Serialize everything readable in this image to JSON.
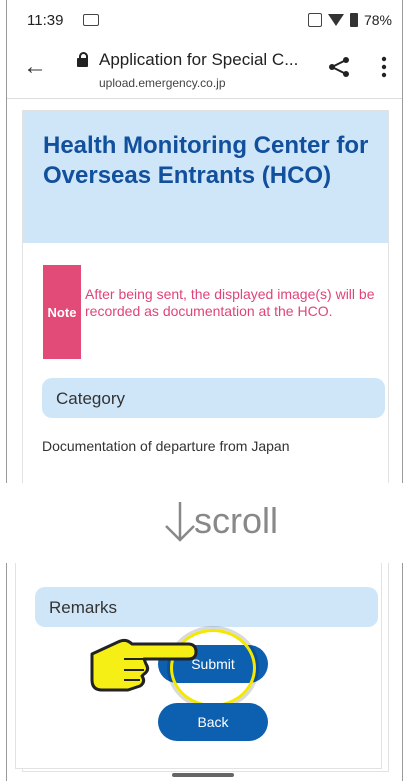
{
  "status_bar": {
    "time": "11:39",
    "battery": "78%"
  },
  "app_bar": {
    "title": "Application for Special C...",
    "url": "upload.emergency.co.jp"
  },
  "header": {
    "title": "Health Monitoring Center for Overseas Entrants (HCO)"
  },
  "note": {
    "badge": "Note",
    "text": "After being sent, the displayed image(s) will be recorded as documentation at the HCO."
  },
  "category": {
    "label": "Category",
    "value": "Documentation of departure from Japan"
  },
  "scroll_hint": {
    "text": "scroll"
  },
  "remarks": {
    "label": "Remarks"
  },
  "buttons": {
    "submit": "Submit",
    "back": "Back"
  },
  "colors": {
    "header_bg": "#cfe6f8",
    "title_blue": "#12509e",
    "note_pink": "#e24a78",
    "button_blue": "#0d5fb0",
    "highlight_yellow": "#f2e800"
  }
}
